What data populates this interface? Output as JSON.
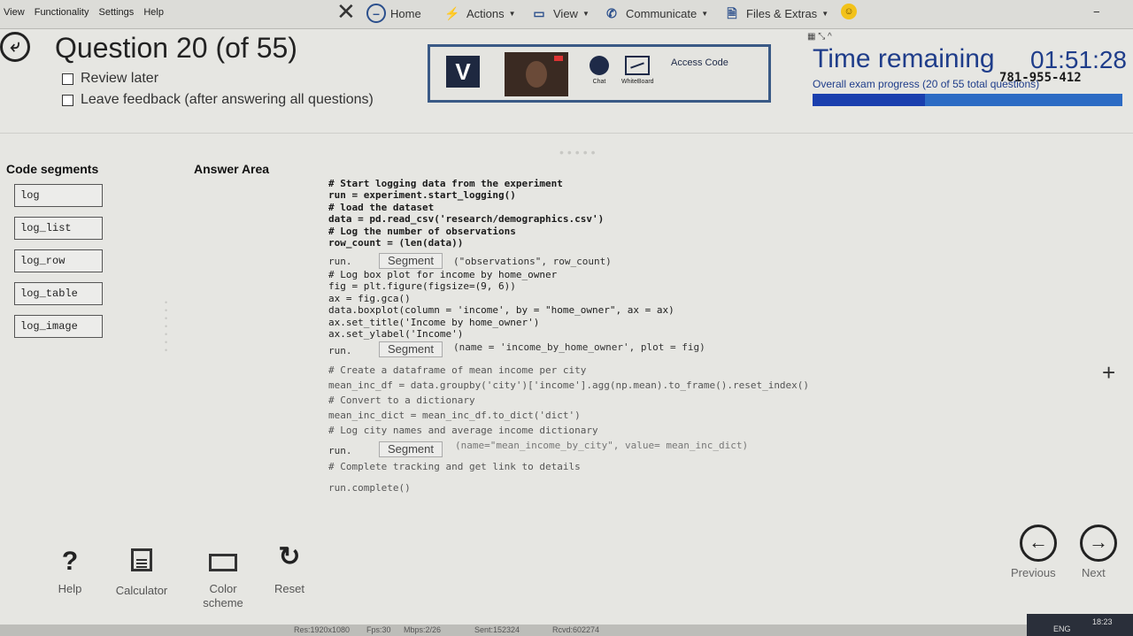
{
  "menu": {
    "items": [
      "View",
      "Functionality",
      "Settings",
      "Help"
    ]
  },
  "toolbar": {
    "home": "Home",
    "actions": "Actions",
    "view": "View",
    "communicate": "Communicate",
    "files": "Files & Extras"
  },
  "question": {
    "title": "Question 20 (of 55)",
    "review_later": "Review later",
    "leave_feedback": "Leave feedback (after answering all questions)"
  },
  "proctor": {
    "logo": "V",
    "chat": "Chat",
    "whiteboard": "WhiteBoard",
    "access_label": "Access Code",
    "access_code": "781-955-412"
  },
  "timer": {
    "label": "Time remaining",
    "value": "01:51:28",
    "progress_label": "Overall exam progress (20 of 55 total questions)",
    "progress_fraction": 0.3636
  },
  "segments": {
    "heading": "Code segments",
    "items": [
      "log",
      "log_list",
      "log_row",
      "log_table",
      "log_image"
    ]
  },
  "answer": {
    "heading": "Answer Area",
    "block1": "# Start logging data from the experiment\nrun = experiment.start_logging()\n# load the dataset\ndata = pd.read_csv('research/demographics.csv')\n# Log the number of observations\nrow_count = (len(data))",
    "run1_pre": "run.",
    "run1_post": "(\"observations\", row_count)",
    "block2": "# Log box plot for income by home_owner\nfig = plt.figure(figsize=(9, 6))\nax = fig.gca()\ndata.boxplot(column = 'income', by = \"home_owner\", ax = ax)\nax.set_title('Income by home_owner')\nax.set_ylabel('Income')",
    "run2_pre": "run.",
    "run2_post": "(name = 'income_by_home_owner', plot = fig)",
    "block3": "# Create a dataframe of mean income per city\nmean_inc_df = data.groupby('city')['income'].agg(np.mean).to_frame().reset_index()\n# Convert to a dictionary\nmean_inc_dict = mean_inc_df.to_dict('dict')\n# Log city names and average income dictionary",
    "run3_pre": "run.",
    "run3_post": "(name=\"mean_income_by_city\", value= mean_inc_dict)",
    "block4": "# Complete tracking and get link to details",
    "block5": "run.complete()",
    "slot_label": "Segment"
  },
  "tools": {
    "help": "Help",
    "calculator": "Calculator",
    "color_scheme": "Color scheme",
    "reset": "Reset"
  },
  "nav": {
    "previous": "Previous",
    "next": "Next"
  },
  "status": {
    "res": "Res:1920x1080",
    "fps": "Fps:30",
    "mbps": "Mbps:2/26",
    "sent": "Sent:152324",
    "rcvd": "Rcvd:602274",
    "lang": "ENG",
    "clock": "18:23"
  }
}
